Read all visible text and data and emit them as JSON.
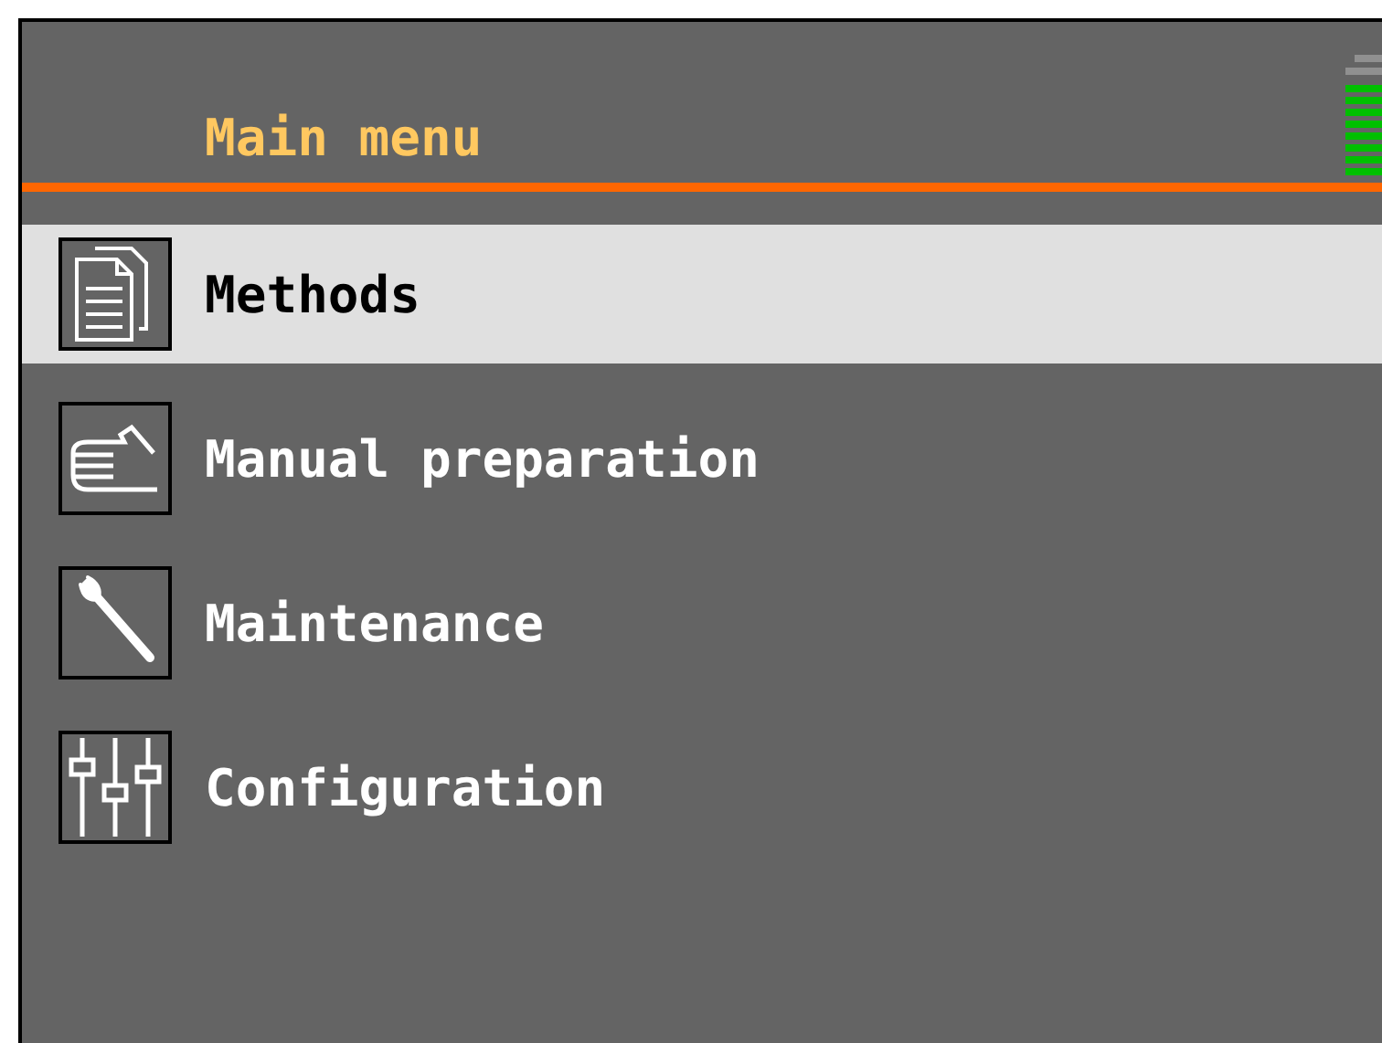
{
  "header": {
    "title": "Main menu"
  },
  "menu": [
    {
      "label": "Methods",
      "selected": true
    },
    {
      "label": "Manual preparation",
      "selected": false
    },
    {
      "label": "Maintenance",
      "selected": false
    },
    {
      "label": "Configuration",
      "selected": false
    }
  ]
}
